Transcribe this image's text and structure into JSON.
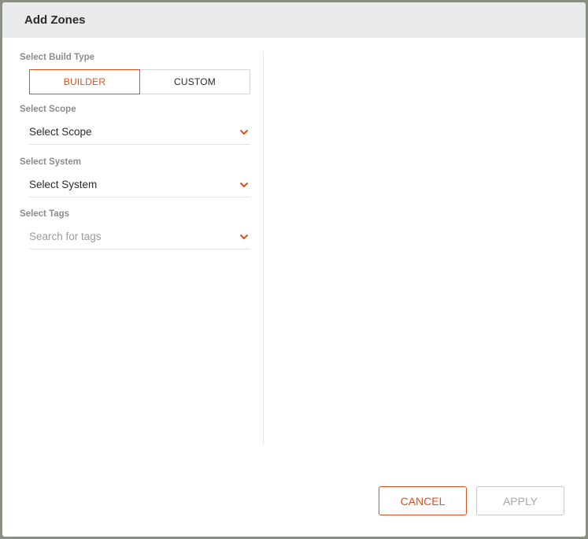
{
  "dialog": {
    "title": "Add Zones"
  },
  "build_type": {
    "label": "Select Build Type",
    "options": [
      "BUILDER",
      "CUSTOM"
    ],
    "selected": "BUILDER"
  },
  "scope": {
    "label": "Select Scope",
    "value": "Select Scope"
  },
  "system": {
    "label": "Select System",
    "value": "Select System"
  },
  "tags": {
    "label": "Select Tags",
    "placeholder": "Search for tags"
  },
  "footer": {
    "cancel_label": "CANCEL",
    "apply_label": "APPLY"
  },
  "colors": {
    "accent": "#d9531e",
    "header_bg": "#e9eaeb"
  },
  "icons": {
    "dropdown": "chevron-down-icon"
  }
}
